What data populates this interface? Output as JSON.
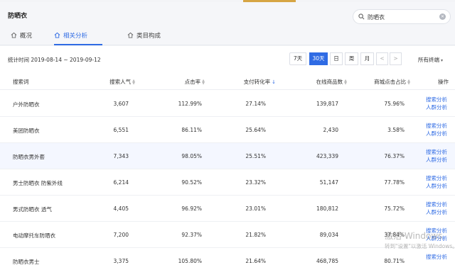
{
  "header": {
    "title": "防晒衣",
    "search_value": "防晒衣",
    "accent": "#2f6be4"
  },
  "tabs": [
    {
      "label": "概况",
      "active": false
    },
    {
      "label": "相关分析",
      "active": true
    },
    {
      "label": "类目构成",
      "active": false
    }
  ],
  "filter": {
    "stat_time": "统计时间 2019-08-14 ~ 2019-09-12",
    "ranges": [
      "7天",
      "30天",
      "日",
      "周",
      "月"
    ],
    "active_range": "30天",
    "prev": "<",
    "next": ">",
    "device": "所有终端"
  },
  "table": {
    "headers": [
      "搜索词",
      "搜索人气",
      "点击率",
      "支付转化率",
      "在线商品数",
      "商城点击占比",
      "操作"
    ],
    "op_labels": [
      "搜索分析",
      "人群分析"
    ],
    "rows": [
      [
        "户外防晒衣",
        "3,607",
        "112.99%",
        "27.14%",
        "139,817",
        "75.96%"
      ],
      [
        "美团防晒衣",
        "6,551",
        "86.11%",
        "25.64%",
        "2,430",
        "3.58%"
      ],
      [
        "防晒衣男外套",
        "7,343",
        "98.05%",
        "25.51%",
        "423,339",
        "76.37%"
      ],
      [
        "男士防晒衣 防紫外线",
        "6,214",
        "90.52%",
        "23.32%",
        "51,147",
        "77.78%"
      ],
      [
        "男式防晒衣 透气",
        "4,405",
        "96.92%",
        "23.01%",
        "180,812",
        "75.72%"
      ],
      [
        "电动摩托车防晒衣",
        "7,200",
        "92.37%",
        "21.82%",
        "89,034",
        "37.84%"
      ],
      [
        "防晒衣男士",
        "3,375",
        "105.80%",
        "21.64%",
        "468,785",
        "80.71%"
      ]
    ]
  },
  "watermark": {
    "line1": "激活 Windows",
    "line2": "转到\"设置\"以激活 Windows。"
  }
}
